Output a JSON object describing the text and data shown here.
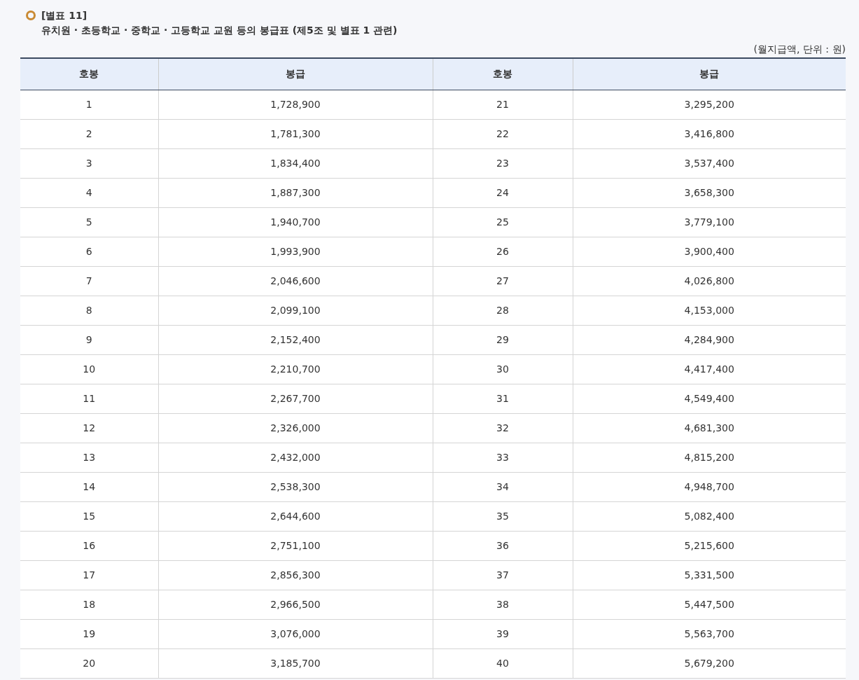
{
  "heading": {
    "label": "[별표 11]",
    "title": "유치원 · 초등학교 · 중학교 · 고등학교 교원 등의 봉급표 (제5조 및 별표 1 관련)"
  },
  "unit_note": "(월지급액, 단위 : 원)",
  "table": {
    "columns": [
      "호봉",
      "봉급",
      "호봉",
      "봉급"
    ],
    "rows": [
      [
        "1",
        "1,728,900",
        "21",
        "3,295,200"
      ],
      [
        "2",
        "1,781,300",
        "22",
        "3,416,800"
      ],
      [
        "3",
        "1,834,400",
        "23",
        "3,537,400"
      ],
      [
        "4",
        "1,887,300",
        "24",
        "3,658,300"
      ],
      [
        "5",
        "1,940,700",
        "25",
        "3,779,100"
      ],
      [
        "6",
        "1,993,900",
        "26",
        "3,900,400"
      ],
      [
        "7",
        "2,046,600",
        "27",
        "4,026,800"
      ],
      [
        "8",
        "2,099,100",
        "28",
        "4,153,000"
      ],
      [
        "9",
        "2,152,400",
        "29",
        "4,284,900"
      ],
      [
        "10",
        "2,210,700",
        "30",
        "4,417,400"
      ],
      [
        "11",
        "2,267,700",
        "31",
        "4,549,400"
      ],
      [
        "12",
        "2,326,000",
        "32",
        "4,681,300"
      ],
      [
        "13",
        "2,432,000",
        "33",
        "4,815,200"
      ],
      [
        "14",
        "2,538,300",
        "34",
        "4,948,700"
      ],
      [
        "15",
        "2,644,600",
        "35",
        "5,082,400"
      ],
      [
        "16",
        "2,751,100",
        "36",
        "5,215,600"
      ],
      [
        "17",
        "2,856,300",
        "37",
        "5,331,500"
      ],
      [
        "18",
        "2,966,500",
        "38",
        "5,447,500"
      ],
      [
        "19",
        "3,076,000",
        "39",
        "5,563,700"
      ],
      [
        "20",
        "3,185,700",
        "40",
        "5,679,200"
      ]
    ]
  }
}
